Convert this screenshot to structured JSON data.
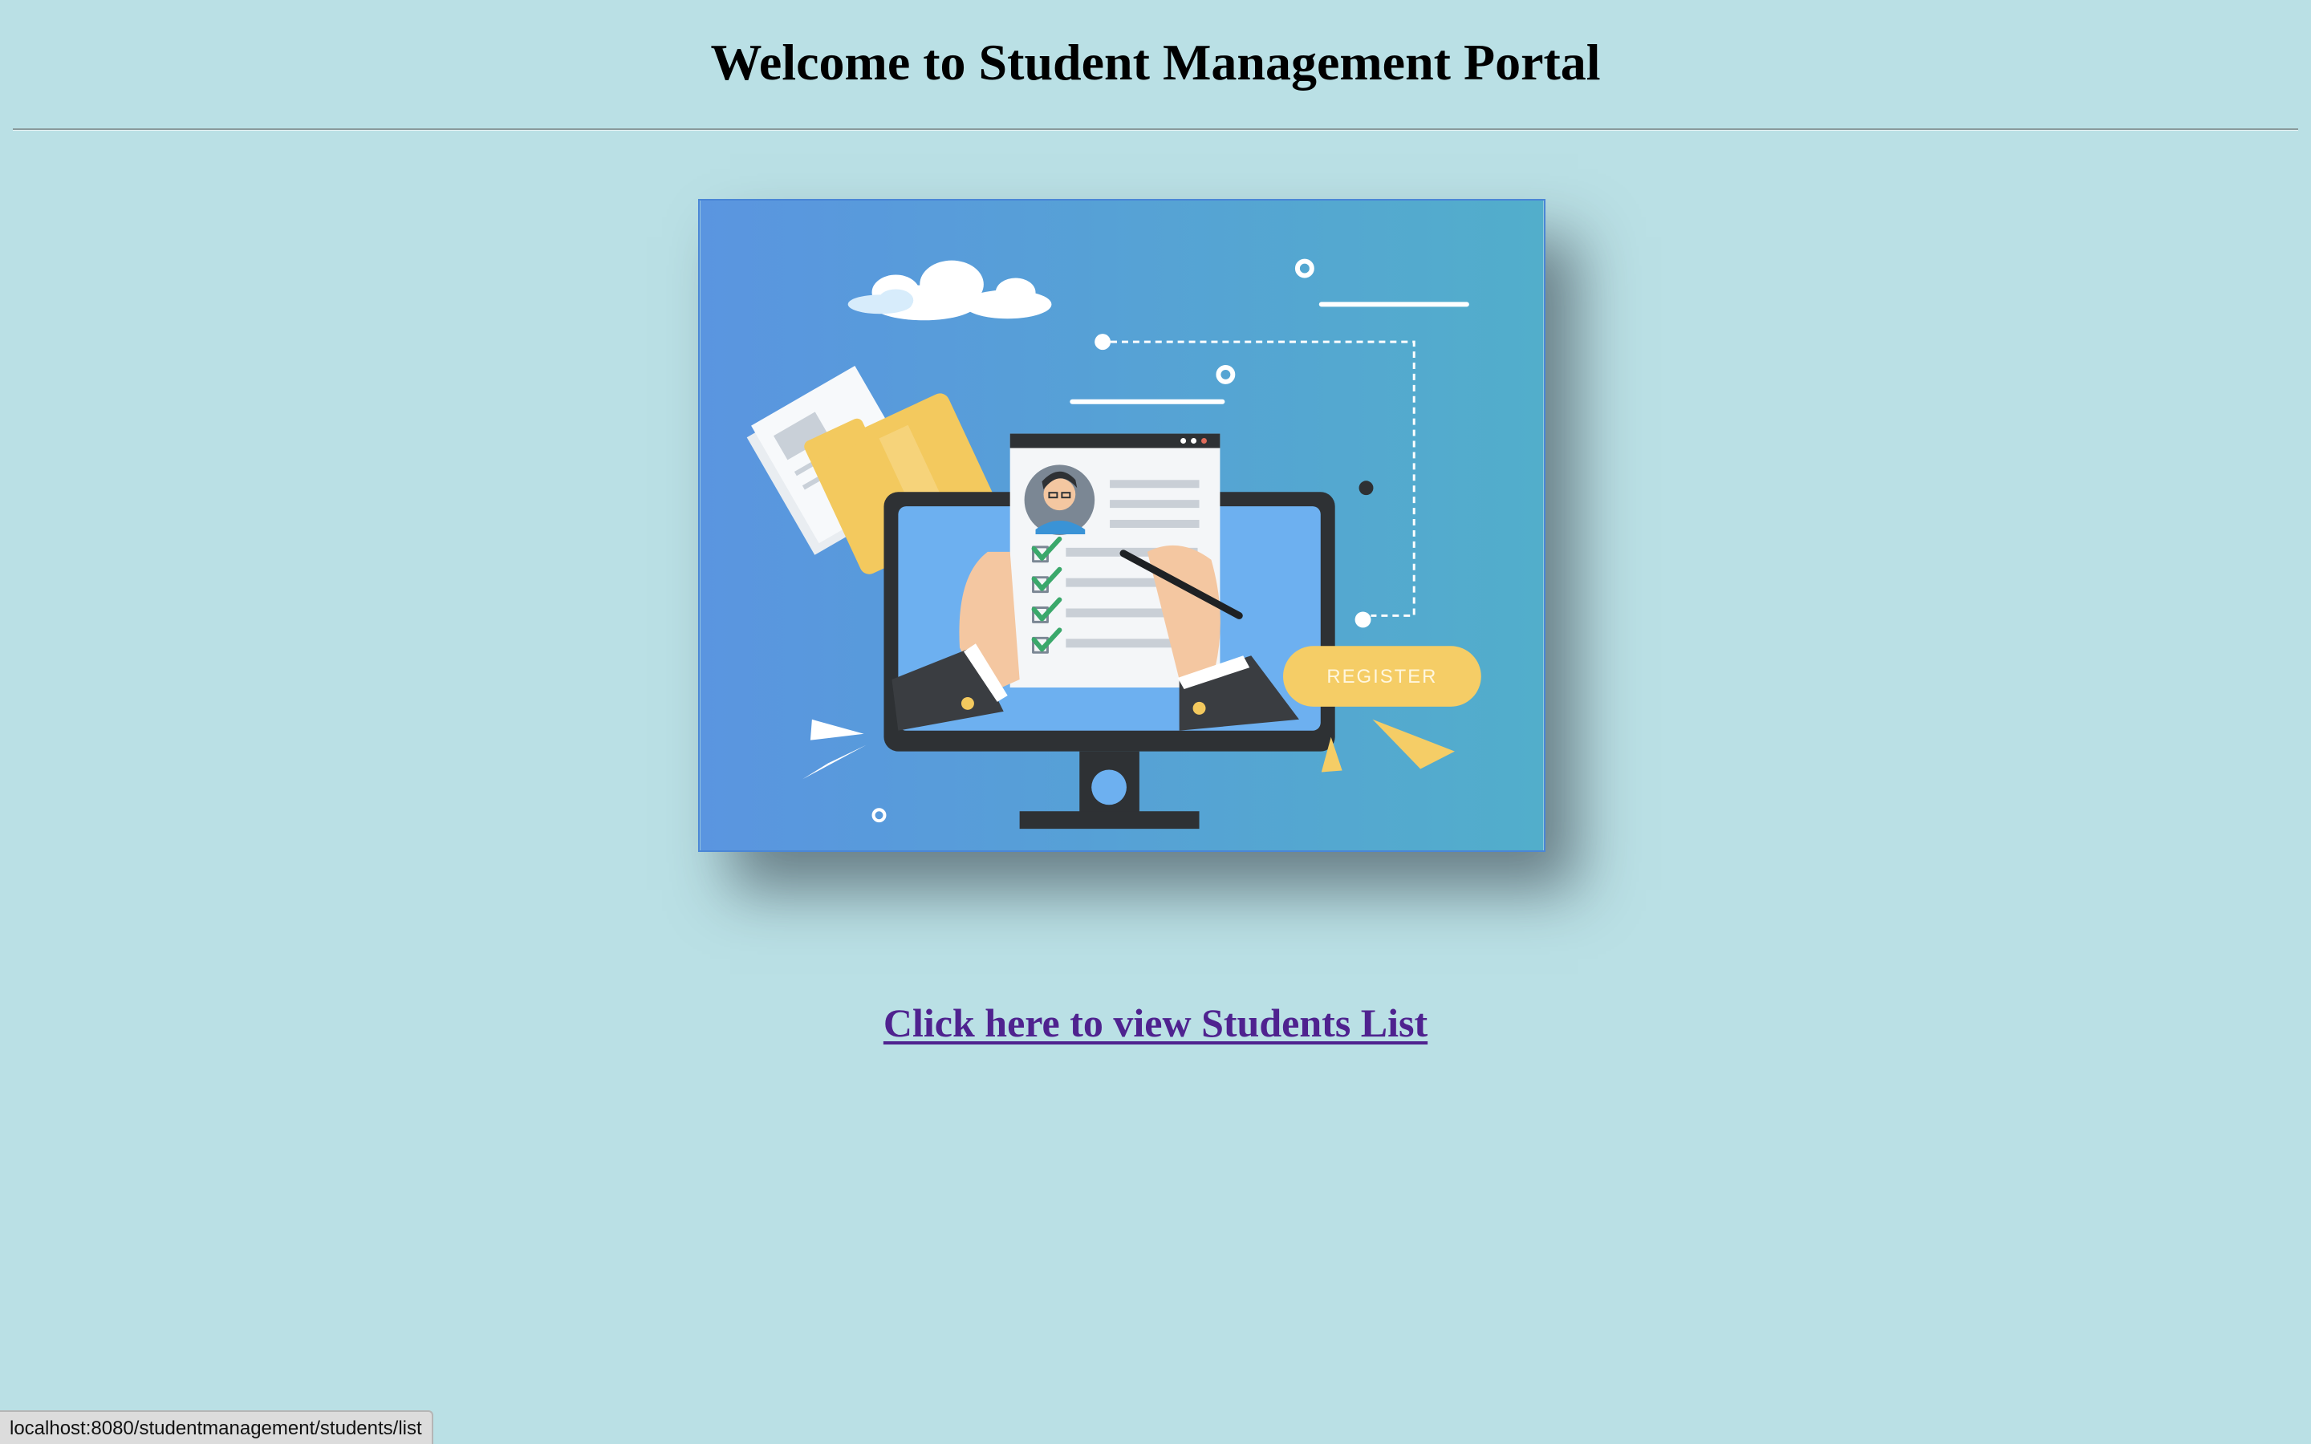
{
  "header": {
    "title": "Welcome to Student Management Portal"
  },
  "illustration": {
    "icon": "student-registration-illustration",
    "register_label": "REGISTER",
    "colors": {
      "background_left": "#5a95e0",
      "background_right": "#52aecb",
      "monitor": "#2e3134",
      "screen": "#6db0f0",
      "folder": "#f3c95e",
      "register_button": "#f5cd66",
      "checkmark": "#3aa86b"
    }
  },
  "main": {
    "link_label": "Click here to view Students List",
    "link_color": "#4f228f"
  },
  "status_bar": {
    "url": "localhost:8080/studentmanagement/students/list"
  },
  "page": {
    "background": "#bae0e5"
  }
}
